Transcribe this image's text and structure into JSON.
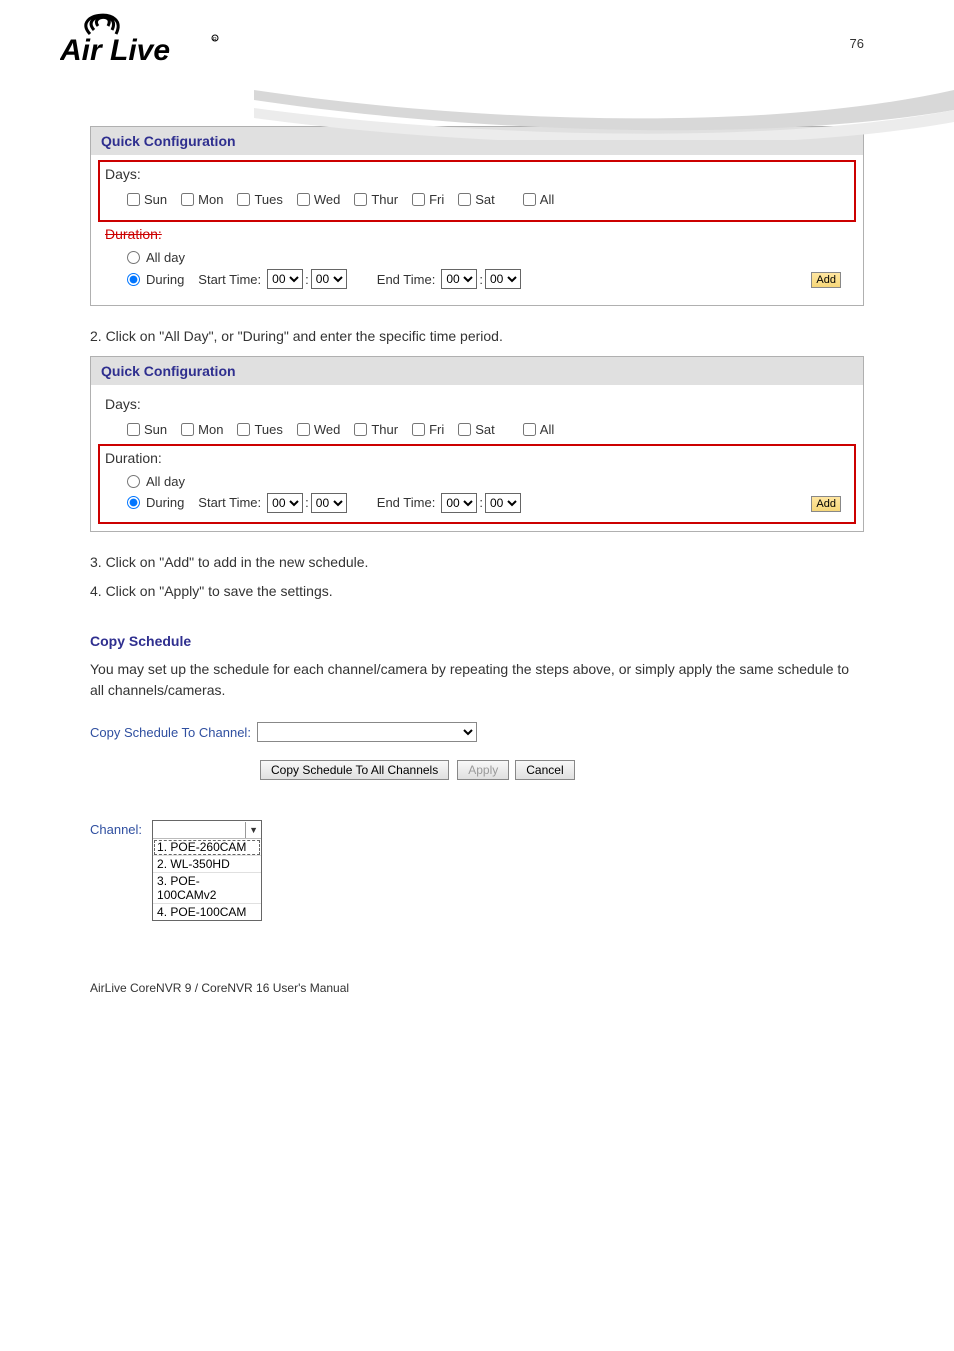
{
  "page_number": "76",
  "footer": "AirLive CoreNVR 9 / CoreNVR 16 User's Manual",
  "logo_alt": "Air Live",
  "panel1": {
    "title": "Quick Configuration",
    "days_label": "Days:",
    "days": [
      "Sun",
      "Mon",
      "Tues",
      "Wed",
      "Thur",
      "Fri",
      "Sat",
      "All"
    ],
    "duration_label": "Duration:",
    "allday": "All day",
    "during": "During",
    "start_time": "Start Time:",
    "end_time": "End Time:",
    "hh": "00",
    "mm": "00",
    "add": "Add"
  },
  "instr1": "2. Click on \"All Day\", or \"During\" and enter the specific time period.",
  "panel2": {
    "title": "Quick Configuration",
    "days_label": "Days:",
    "days": [
      "Sun",
      "Mon",
      "Tues",
      "Wed",
      "Thur",
      "Fri",
      "Sat",
      "All"
    ],
    "duration_label": "Duration:",
    "allday": "All day",
    "during": "During",
    "start_time": "Start Time:",
    "end_time": "End Time:",
    "hh": "00",
    "mm": "00",
    "add": "Add"
  },
  "instr2": "3. Click on \"Add\" to add in the new schedule.",
  "instr3": "4. Click on \"Apply\" to save the settings.",
  "copy_schedule": {
    "heading": "Copy Schedule",
    "body": "You may set up the schedule for each channel/camera by repeating the steps above, or simply apply the same schedule to all channels/cameras.",
    "label": "Copy Schedule To Channel:",
    "btn_all": "Copy Schedule To All Channels",
    "btn_apply": "Apply",
    "btn_cancel": "Cancel"
  },
  "channel": {
    "label": "Channel:",
    "options": [
      "1. POE-260CAM",
      "2. WL-350HD",
      "3. POE-100CAMv2",
      "4. POE-100CAM"
    ]
  }
}
